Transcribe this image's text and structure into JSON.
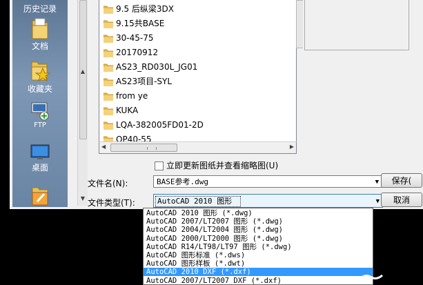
{
  "places": [
    {
      "label": "历史记录",
      "icon": "history-icon"
    },
    {
      "label": "文档",
      "icon": "documents-icon"
    },
    {
      "label": "收藏夹",
      "icon": "favorites-icon"
    },
    {
      "label": "FTP",
      "icon": "ftp-icon"
    },
    {
      "label": "桌面",
      "icon": "desktop-icon"
    },
    {
      "label": "",
      "icon": "buzzsaw-icon"
    }
  ],
  "files": [
    "9.5 后纵梁3DX",
    "9.15共BASE",
    "30-45-75",
    "20170912",
    "AS23_RD030L_JG01",
    "AS23项目-SYL",
    "from  ye",
    "KUKA",
    "LQA-382005FD01-2D",
    "OP40-55"
  ],
  "checkbox_label": "立即更新图纸并查看缩略图(U)",
  "filename_label": "文件名(N):",
  "filename_value": "BASE参考.dwg",
  "filetype_label": "文件类型(T):",
  "filetype_value": "AutoCAD 2010 图形 (*.dwg)",
  "save_button": "保存(",
  "cancel_button": "取消",
  "filetype_options": [
    "AutoCAD 2010 图形 (*.dwg)",
    "AutoCAD 2007/LT2007 图形 (*.dwg)",
    "AutoCAD 2004/LT2004 图形 (*.dwg)",
    "AutoCAD 2000/LT2000 图形 (*.dwg)",
    "AutoCAD R14/LT98/LT97 图形 (*.dwg)",
    "AutoCAD 图形标准 (*.dws)",
    "AutoCAD 图形样板 (*.dwt)",
    "AutoCAD 2010 DXF (*.dxf)",
    "AutoCAD 2007/LT2007 DXF (*.dxf)"
  ],
  "highlighted_option_index": 7,
  "colors": {
    "highlight": "#3399ff",
    "places_bar": "#6a84a4"
  }
}
